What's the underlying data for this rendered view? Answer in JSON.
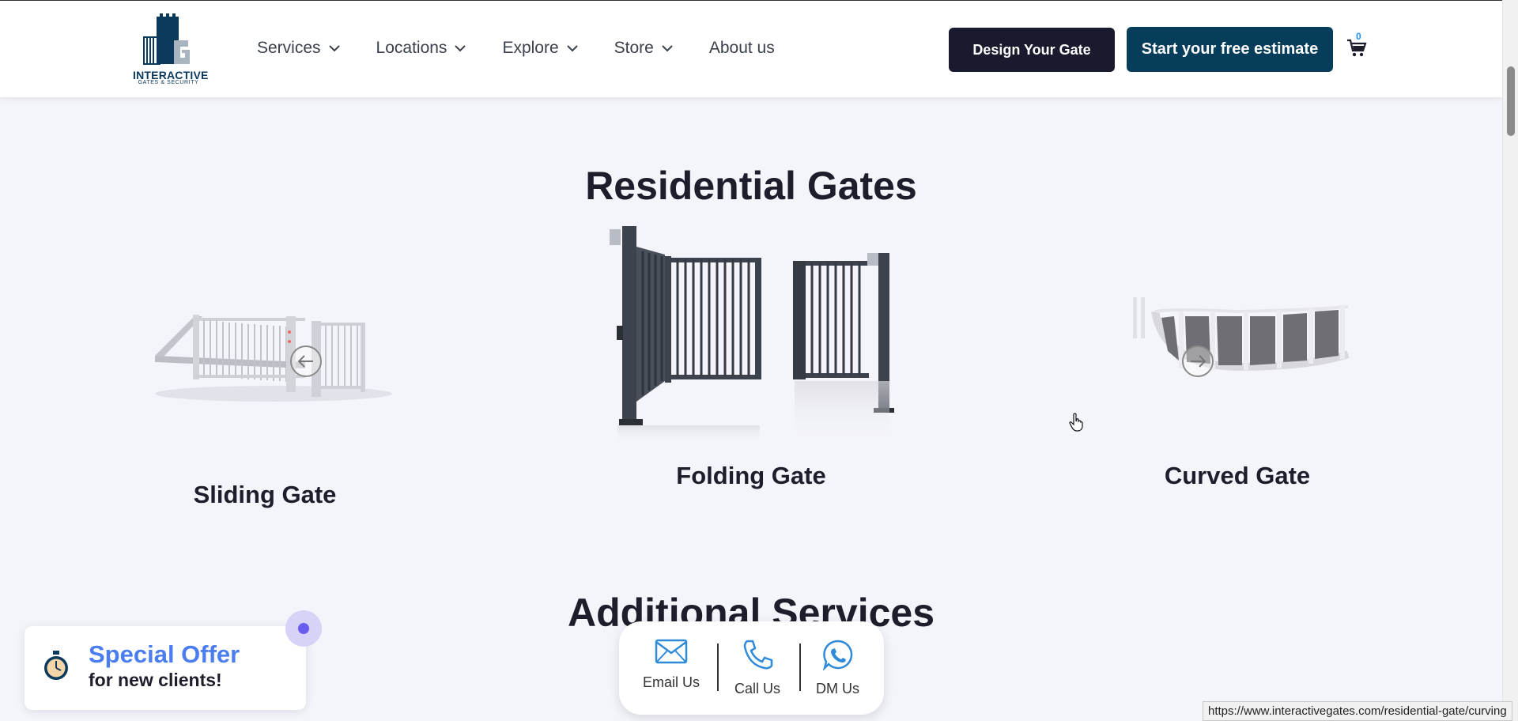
{
  "header": {
    "logo_text": "INTERACTIVE",
    "logo_subtext": "GATES & SECURITY",
    "nav": [
      {
        "label": "Services"
      },
      {
        "label": "Locations"
      },
      {
        "label": "Explore"
      },
      {
        "label": "Store"
      },
      {
        "label": "About us"
      }
    ],
    "design_button": "Design Your Gate",
    "estimate_button": "Start your free estimate",
    "cart_count": "0"
  },
  "residential": {
    "title": "Residential Gates",
    "gates": [
      {
        "label": "Sliding Gate"
      },
      {
        "label": "Folding Gate"
      },
      {
        "label": "Curved Gate"
      }
    ]
  },
  "additional": {
    "title": "Additional Services"
  },
  "offer": {
    "title": "Special Offer",
    "subtitle": "for new clients!"
  },
  "contact": {
    "email": "Email Us",
    "call": "Call Us",
    "dm": "DM Us"
  },
  "status_url": "https://www.interactivegates.com/residential-gate/curving",
  "colors": {
    "brand_dark": "#1a1a2e",
    "brand_teal": "#063d5a",
    "offer_blue": "#4a7df0",
    "background": "#f4f4fb"
  }
}
